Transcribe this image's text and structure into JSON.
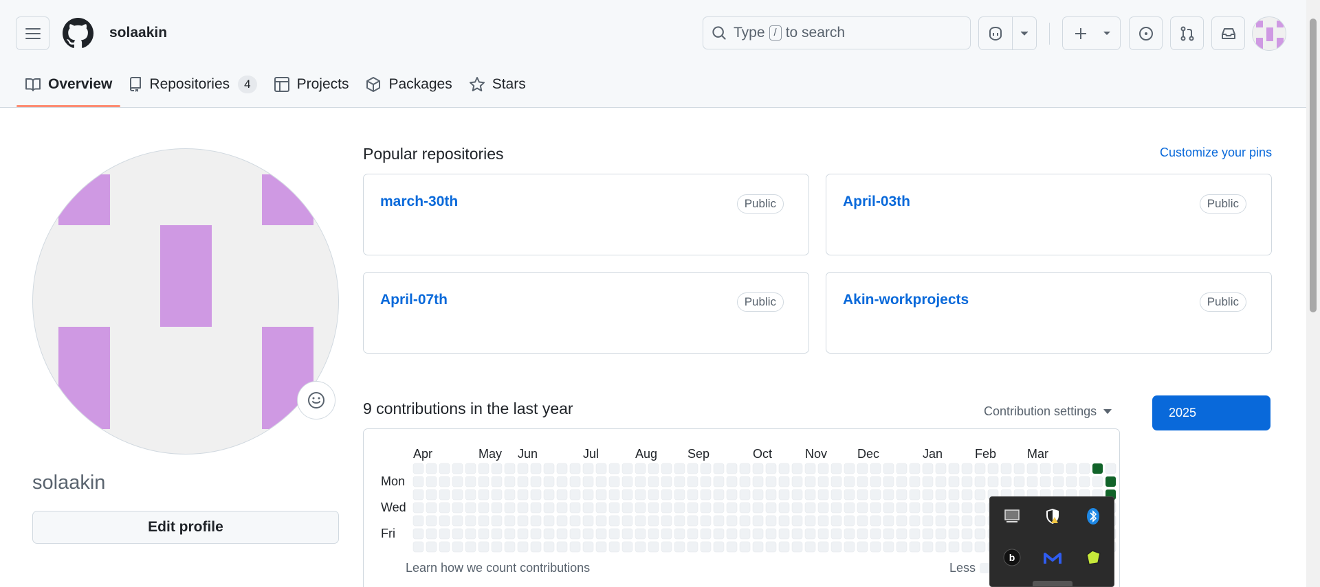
{
  "header": {
    "username": "solaakin",
    "search": {
      "before": "Type",
      "key": "/",
      "after": "to search"
    }
  },
  "tabs": [
    {
      "label": "Overview",
      "icon": "book-icon",
      "active": true
    },
    {
      "label": "Repositories",
      "icon": "repo-icon",
      "count": "4"
    },
    {
      "label": "Projects",
      "icon": "table-icon"
    },
    {
      "label": "Packages",
      "icon": "package-icon"
    },
    {
      "label": "Stars",
      "icon": "star-icon"
    }
  ],
  "profile": {
    "name": "solaakin",
    "edit_label": "Edit profile",
    "avatar_color": "#cf99e3"
  },
  "popular": {
    "title": "Popular repositories",
    "customize_label": "Customize your pins",
    "repos": [
      {
        "name": "march-30th",
        "visibility": "Public"
      },
      {
        "name": "April-03th",
        "visibility": "Public"
      },
      {
        "name": "April-07th",
        "visibility": "Public"
      },
      {
        "name": "Akin-workprojects",
        "visibility": "Public"
      }
    ]
  },
  "contributions": {
    "title": "9 contributions in the last year",
    "settings_label": "Contribution settings",
    "year": "2025",
    "months": [
      "Apr",
      "May",
      "Jun",
      "Jul",
      "Aug",
      "Sep",
      "Oct",
      "Nov",
      "Dec",
      "Jan",
      "Feb",
      "Mar"
    ],
    "days": [
      "Mon",
      "Wed",
      "Fri"
    ],
    "learn_label": "Learn how we count contributions",
    "legend_less": "Less",
    "empty_color": "#eff2f5",
    "active_color": "#116329"
  },
  "tray": {
    "icons": [
      "display-icon",
      "defender-shield-icon",
      "bluetooth-icon",
      "beats-icon",
      "malwarebytes-icon",
      "lime-app-icon"
    ]
  }
}
